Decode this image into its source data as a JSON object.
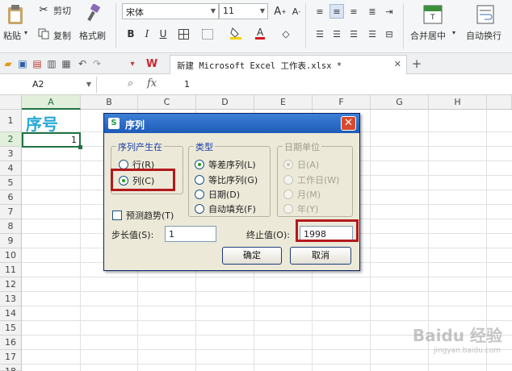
{
  "ribbon": {
    "paste": "粘贴",
    "cut": "剪切",
    "copy": "复制",
    "format_painter": "格式刷",
    "font_name": "宋体",
    "font_size": "11",
    "merge_center": "合并居中",
    "wrap_text": "自动换行"
  },
  "file_tab": {
    "title": "新建 Microsoft Excel 工作表.xlsx *"
  },
  "formula_bar": {
    "name_box": "A2",
    "fx": "fx",
    "value": "1"
  },
  "grid": {
    "columns": [
      "A",
      "B",
      "C",
      "D",
      "E",
      "F",
      "G",
      "H"
    ],
    "rows": [
      "1",
      "2",
      "3",
      "4",
      "5",
      "6",
      "7",
      "8",
      "9",
      "10",
      "11",
      "12",
      "13",
      "14",
      "15",
      "16",
      "17",
      "18"
    ],
    "a1": "序号",
    "a2": "1"
  },
  "dialog": {
    "title": "序列",
    "series_in": {
      "title": "序列产生在",
      "row": "行(R)",
      "column": "列(C)",
      "selected": "column"
    },
    "type": {
      "title": "类型",
      "linear": "等差序列(L)",
      "growth": "等比序列(G)",
      "date": "日期(D)",
      "autofill": "自动填充(F)",
      "selected": "linear"
    },
    "date_unit": {
      "title": "日期单位",
      "day": "日(A)",
      "weekday": "工作日(W)",
      "month": "月(M)",
      "year": "年(Y)"
    },
    "trend": "预测趋势(T)",
    "step_label": "步长值(S):",
    "step_value": "1",
    "stop_label": "终止值(O):",
    "stop_value": "1998",
    "ok": "确定",
    "cancel": "取消"
  },
  "colors": {
    "accent_green": "#217346",
    "title_cyan": "#29a8d6",
    "highlight_red": "#b3191c"
  },
  "watermark": {
    "text": "Baidu 经验",
    "sub": "jingyan.baidu.com"
  }
}
